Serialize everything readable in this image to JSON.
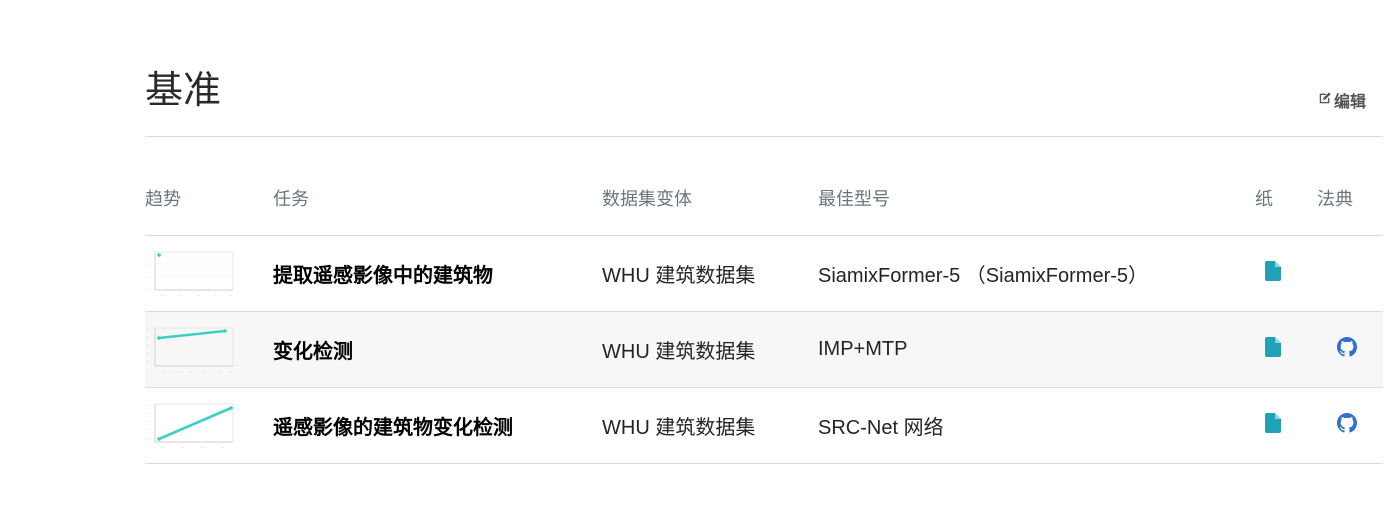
{
  "section": {
    "title": "基准",
    "edit_label": "编辑"
  },
  "table": {
    "headers": {
      "trend": "趋势",
      "task": "任务",
      "dataset": "数据集变体",
      "model": "最佳型号",
      "paper": "纸",
      "code": "法典"
    },
    "rows": [
      {
        "task": "提取遥感影像中的建筑物",
        "dataset": "WHU 建筑数据集",
        "model": "SiamixFormer-5 （SiamixFormer-5）",
        "has_paper": true,
        "has_code": false
      },
      {
        "task": "变化检测",
        "dataset": "WHU 建筑数据集",
        "model": "IMP+MTP",
        "has_paper": true,
        "has_code": true
      },
      {
        "task": "遥感影像的建筑物变化检测",
        "dataset": "WHU 建筑数据集",
        "model": "SRC-Net 网络",
        "has_paper": true,
        "has_code": true
      }
    ]
  },
  "colors": {
    "accent": "#21a1b5",
    "trend_line": "#3ccfc4",
    "code_icon": "#2f6fd0"
  },
  "icons": {
    "edit": "edit-icon",
    "paper": "file-icon",
    "code": "github-icon"
  }
}
